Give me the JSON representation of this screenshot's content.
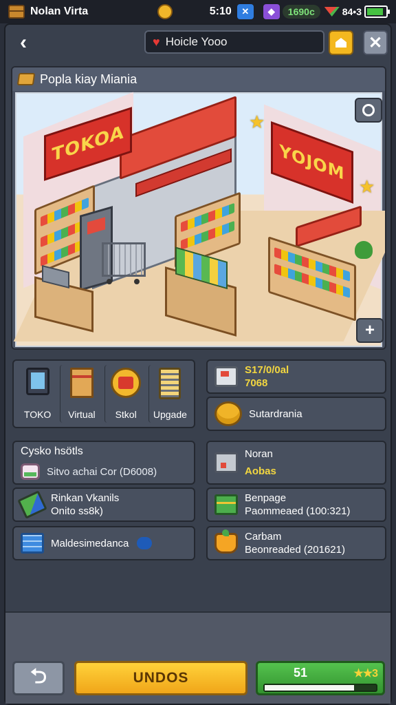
{
  "status_bar": {
    "app_name": "Nolan Virta",
    "time": "5:10",
    "gem_count": "1690c",
    "battery_text": "84•3",
    "battery_level": 0.9
  },
  "top_bar": {
    "title": "Hoicle Yooo"
  },
  "store": {
    "header": "Popla kiay Miania",
    "sign_left": "TOKOA",
    "sign_right": "YOJOM"
  },
  "categories": [
    {
      "label": "TOKO",
      "icon": "tablet-icon"
    },
    {
      "label": "Virtual",
      "icon": "box-icon"
    },
    {
      "label": "Stkol",
      "icon": "badge-icon"
    },
    {
      "label": "Upgade",
      "icon": "phone-icon"
    }
  ],
  "right_cards": [
    {
      "line1": "S17/0/0al",
      "line2": "7068",
      "icon": "register-icon",
      "yellow": true
    },
    {
      "line1": "Sutardrania",
      "line2": "",
      "icon": "coins-icon",
      "yellow": false
    }
  ],
  "left_list": {
    "section_title": "Cysko hsötls",
    "items": [
      {
        "line1": "Sitvo achai Cor (D6008)",
        "line2": "",
        "icon": "jar-icon"
      },
      {
        "line1": "Rinkan Vkanils",
        "line2": "Onito ss8k)",
        "icon": "pencil-icon"
      },
      {
        "line1": "Maldesimedanca",
        "line2": "",
        "icon": "book-icon"
      }
    ]
  },
  "right_list": [
    {
      "line1": "Noran",
      "line2": "Aobas",
      "icon": "machine-icon",
      "yellow_second": true
    },
    {
      "line1": "Benpage",
      "line2": "Paommeaed (100:321)",
      "icon": "crate-icon",
      "yellow_second": false
    },
    {
      "line1": "Carbam",
      "line2": "Beonreaded (201621)",
      "icon": "bag-icon",
      "yellow_second": false
    }
  ],
  "bottom": {
    "main_button": "UNDOS",
    "level": "51",
    "stars": "★★3",
    "xp_progress": 0.8
  },
  "colors": {
    "accent_yellow": "#f4b81f",
    "accent_green": "#54c24e",
    "sign_red": "#d7322a",
    "panel": "#48505f"
  }
}
